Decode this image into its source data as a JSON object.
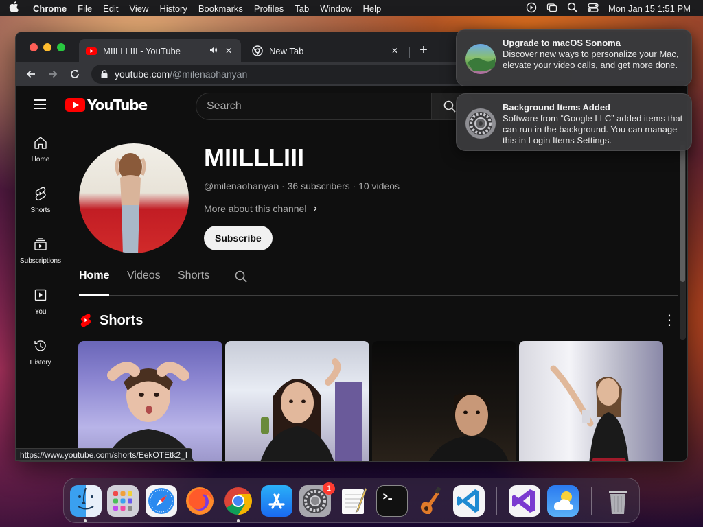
{
  "menubar": {
    "apple": "",
    "items": [
      "Chrome",
      "File",
      "Edit",
      "View",
      "History",
      "Bookmarks",
      "Profiles",
      "Tab",
      "Window",
      "Help"
    ],
    "clock": "Mon Jan 15  1:51 PM"
  },
  "browser": {
    "tabs": [
      {
        "title": "MIILLLIII - YouTube",
        "active": true
      },
      {
        "title": "New Tab",
        "active": false
      }
    ],
    "url_host": "youtube.com",
    "url_path": "/@milenaohanyan",
    "status_url": "https://www.youtube.com/shorts/EekOTEtk2_I"
  },
  "youtube": {
    "logo_text": "YouTube",
    "search_placeholder": "Search",
    "guide": [
      {
        "label": "Home",
        "icon": "home-icon"
      },
      {
        "label": "Shorts",
        "icon": "shorts-icon"
      },
      {
        "label": "Subscriptions",
        "icon": "subscriptions-icon"
      },
      {
        "label": "You",
        "icon": "you-icon"
      },
      {
        "label": "History",
        "icon": "history-icon"
      }
    ],
    "channel": {
      "name": "MIILLLIII",
      "meta": "@milenaohanyan · 36 subscribers · 10 videos",
      "more": "More about this channel",
      "subscribe": "Subscribe"
    },
    "tabs": [
      {
        "label": "Home",
        "active": true
      },
      {
        "label": "Videos",
        "active": false
      },
      {
        "label": "Shorts",
        "active": false
      }
    ],
    "shorts_section": {
      "title": "Shorts"
    }
  },
  "notifications": [
    {
      "title": "Upgrade to macOS Sonoma",
      "body": "Discover new ways to personalize your Mac, elevate your video calls, and get more done."
    },
    {
      "title": "Background Items Added",
      "body": "Software from “Google LLC” added items that can run in the background. You can manage this in Login Items Settings."
    }
  ],
  "dock": {
    "apps": [
      "Finder",
      "Launchpad",
      "Safari",
      "Firefox",
      "Google Chrome",
      "App Store",
      "System Settings",
      "TextEdit",
      "Terminal",
      "GarageBand",
      "Visual Studio Code",
      "Visual Studio",
      "Weather",
      "Trash"
    ],
    "settings_badge": "1"
  },
  "colors": {
    "yt_red": "#ff0000",
    "yt_bg": "#0f0f0f",
    "chrome_tab": "#35363a",
    "chrome_frame": "#202124"
  }
}
